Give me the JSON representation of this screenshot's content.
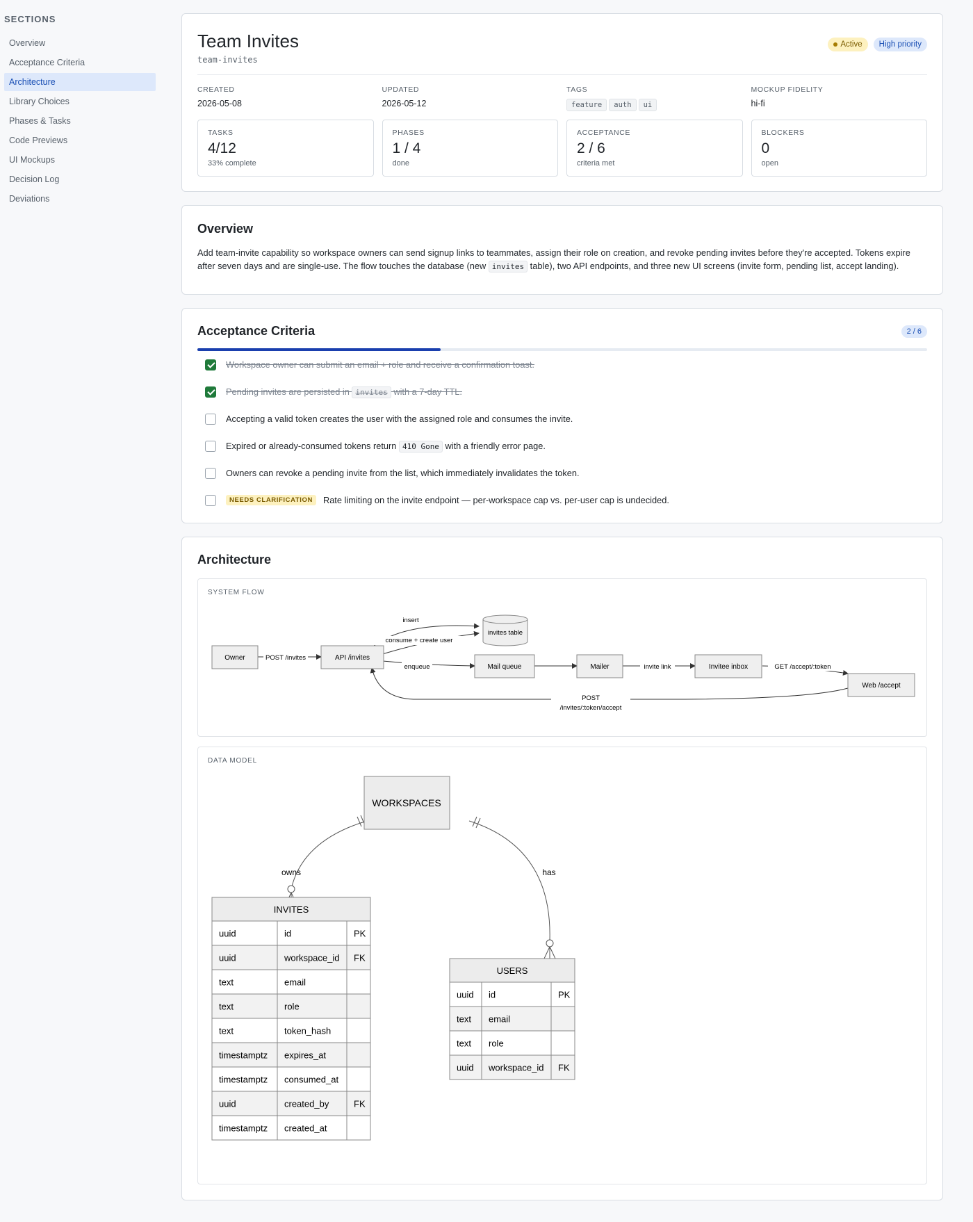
{
  "sidebar": {
    "heading": "SECTIONS",
    "items": [
      {
        "label": "Overview"
      },
      {
        "label": "Acceptance Criteria"
      },
      {
        "label": "Architecture",
        "active": true
      },
      {
        "label": "Library Choices"
      },
      {
        "label": "Phases & Tasks"
      },
      {
        "label": "Code Previews"
      },
      {
        "label": "UI Mockups"
      },
      {
        "label": "Decision Log"
      },
      {
        "label": "Deviations"
      }
    ]
  },
  "header": {
    "title": "Team Invites",
    "slug": "team-invites",
    "status_badge": "Active",
    "priority_badge": "High priority",
    "meta": {
      "created_label": "CREATED",
      "created": "2026-05-08",
      "updated_label": "UPDATED",
      "updated": "2026-05-12",
      "tags_label": "TAGS",
      "tags": [
        "feature",
        "auth",
        "ui"
      ],
      "fidelity_label": "MOCKUP FIDELITY",
      "fidelity": "hi-fi"
    },
    "stats": [
      {
        "label": "TASKS",
        "value": "4/12",
        "sub": "33% complete"
      },
      {
        "label": "PHASES",
        "value": "1 / 4",
        "sub": "done"
      },
      {
        "label": "ACCEPTANCE",
        "value": "2 / 6",
        "sub": "criteria met"
      },
      {
        "label": "BLOCKERS",
        "value": "0",
        "sub": "open"
      }
    ]
  },
  "overview": {
    "title": "Overview",
    "text_1": "Add team-invite capability so workspace owners can send signup links to teammates, assign their role on creation, and revoke pending invites before they're accepted. Tokens expire after seven days and are single-use. The flow touches the database (new ",
    "code": "invites",
    "text_2": " table), two API endpoints, and three new UI screens (invite form, pending list, accept landing)."
  },
  "acceptance": {
    "title": "Acceptance Criteria",
    "count": "2 / 6",
    "progress": 0.333,
    "criteria": [
      {
        "done": true,
        "text": "Workspace owner can submit an email + role and receive a confirmation toast."
      },
      {
        "done": true,
        "pre": "Pending invites are persisted in ",
        "code": "invites",
        "post": " with a 7-day TTL."
      },
      {
        "done": false,
        "text": "Accepting a valid token creates the user with the assigned role and consumes the invite."
      },
      {
        "done": false,
        "pre": "Expired or already-consumed tokens return ",
        "code": "410 Gone",
        "post": " with a friendly error page."
      },
      {
        "done": false,
        "text": "Owners can revoke a pending invite from the list, which immediately invalidates the token."
      },
      {
        "done": false,
        "flag": "NEEDS CLARIFICATION",
        "text": "Rate limiting on the invite endpoint — per-workspace cap vs. per-user cap is undecided."
      }
    ]
  },
  "architecture": {
    "title": "Architecture",
    "flow": {
      "label": "SYSTEM FLOW",
      "nodes": {
        "owner": "Owner",
        "api": "API /invites",
        "db": "invites table",
        "mail_queue": "Mail queue",
        "mailer": "Mailer",
        "inbox": "Invitee inbox",
        "web": "Web /accept"
      },
      "edges": {
        "post_invites": "POST /invites",
        "insert": "insert",
        "consume": "consume + create user",
        "enqueue": "enqueue",
        "invite_link": "invite link",
        "get_accept": "GET /accept/:token",
        "post_accept_1": "POST",
        "post_accept_2": "/invites/:token/accept"
      }
    },
    "data_model": {
      "label": "DATA MODEL",
      "workspaces": "WORKSPACES",
      "rel_owns": "owns",
      "rel_has": "has",
      "invites": {
        "name": "INVITES",
        "rows": [
          [
            "uuid",
            "id",
            "PK"
          ],
          [
            "uuid",
            "workspace_id",
            "FK"
          ],
          [
            "text",
            "email",
            ""
          ],
          [
            "text",
            "role",
            ""
          ],
          [
            "text",
            "token_hash",
            ""
          ],
          [
            "timestamptz",
            "expires_at",
            ""
          ],
          [
            "timestamptz",
            "consumed_at",
            ""
          ],
          [
            "uuid",
            "created_by",
            "FK"
          ],
          [
            "timestamptz",
            "created_at",
            ""
          ]
        ]
      },
      "users": {
        "name": "USERS",
        "rows": [
          [
            "uuid",
            "id",
            "PK"
          ],
          [
            "text",
            "email",
            ""
          ],
          [
            "text",
            "role",
            ""
          ],
          [
            "uuid",
            "workspace_id",
            "FK"
          ]
        ]
      }
    }
  }
}
